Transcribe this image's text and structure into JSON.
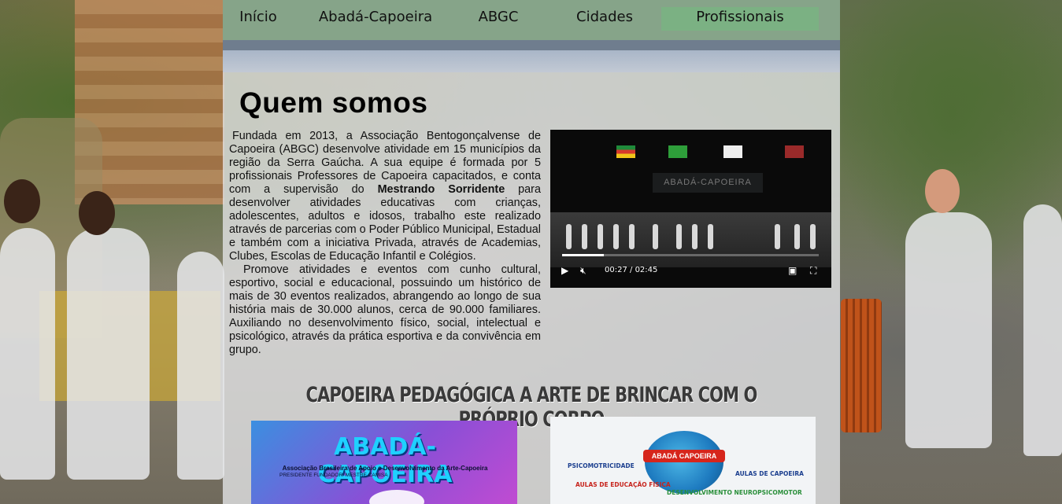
{
  "nav": {
    "items": [
      {
        "label": "Início"
      },
      {
        "label": "Abadá-Capoeira"
      },
      {
        "label": "ABGC"
      },
      {
        "label": "Cidades"
      },
      {
        "label": "Profissionais"
      }
    ],
    "active_index": 4
  },
  "main": {
    "title": "Quem somos",
    "paragraph1": {
      "before_bold": "Fundada em 2013, a Associação Bentogonçalvense de Capoeira (ABGC) desenvolve atividade em 15 municípios da região da Serra Gaúcha. A sua equipe é formada por 5 profissionais Professores de Capoeira capacitados, e conta com a supervisão do ",
      "bold": "Mestrando Sorridente",
      "after_bold": " para desenvolver atividades educativas com crianças, adolescentes, adultos e idosos, trabalho este realizado através de parcerias com o Poder Público Municipal, Estadual e também com a iniciativa Privada, através de Academias, Clubes, Escolas de Educação Infantil e Colégios."
    },
    "paragraph2": "Promove atividades e eventos com cunho cultural, esportivo, social e educacional, possuindo um histórico de mais de 30 eventos realizados, abrangendo ao longo de sua história mais de 30.000 alunos, cerca de 90.000 familiares. Auxiliando no desenvolvimento físico, social, intelectual e psicológico, através da prática esportiva e da convivência em grupo.",
    "banner": "CAPOEIRA PEDAGÓGICA A ARTE DE BRINCAR COM O PRÓPRIO CORPO"
  },
  "video": {
    "current_time": "00:27",
    "separator": " / ",
    "duration": "02:45",
    "progress": 0.164,
    "stage_banner": "ABADÁ-CAPOEIRA",
    "icons": {
      "play": "play-icon",
      "mute": "volume-muted-icon",
      "pip": "picture-in-picture-icon",
      "fullscreen": "fullscreen-icon"
    }
  },
  "images": {
    "left": {
      "logo": "ABADÁ-CAPOEIRA",
      "subtitle": "Associação Brasileira de Apoio e Desenvolvimento da Arte-Capoeira",
      "founder": "PRESIDENTE FUNDADOR: MESTRE CAMISA"
    },
    "right": {
      "badge": "ABADÁ CAPOEIRA",
      "psico": "PSICOMOTRICIDADE",
      "edfis": "AULAS DE EDUCAÇÃO FÍSICA",
      "capoeira": "AULAS DE CAPOEIRA",
      "neuro": "DESENVOLVIMENTO NEUROPSICOMOTOR"
    }
  },
  "colors": {
    "nav_bg": "#86a489",
    "nav_active": "#7bb183",
    "column_bg": "#e4e6e8"
  }
}
